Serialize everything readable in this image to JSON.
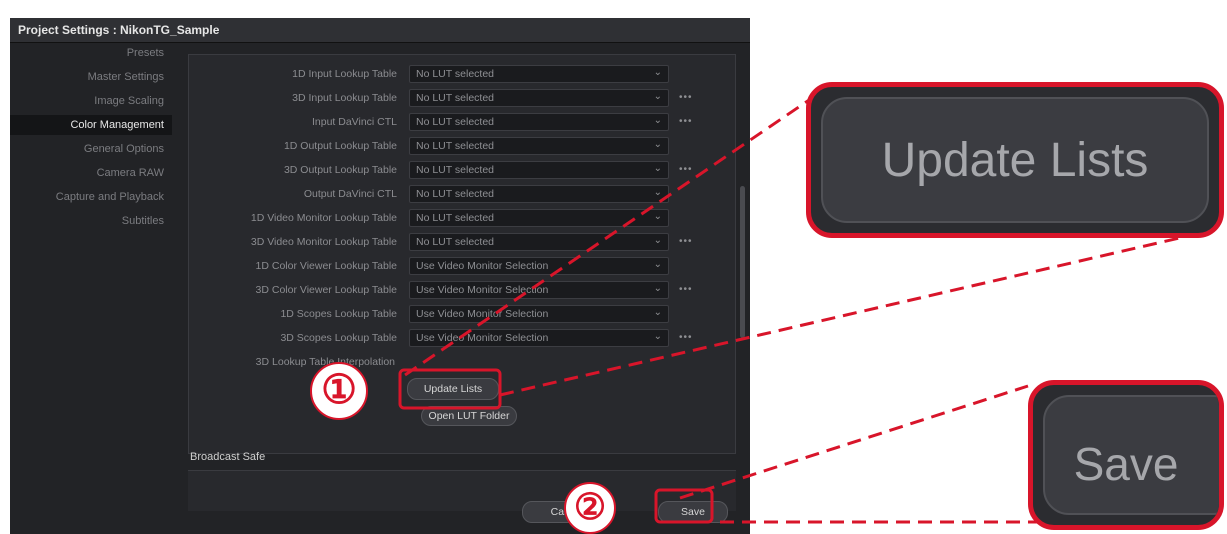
{
  "window": {
    "title": "Project Settings :  NikonTG_Sample"
  },
  "sidebar": {
    "items": [
      {
        "label": "Presets",
        "active": false
      },
      {
        "label": "Master Settings",
        "active": false
      },
      {
        "label": "Image Scaling",
        "active": false
      },
      {
        "label": "Color Management",
        "active": true
      },
      {
        "label": "General Options",
        "active": false
      },
      {
        "label": "Camera RAW",
        "active": false
      },
      {
        "label": "Capture and Playback",
        "active": false
      },
      {
        "label": "Subtitles",
        "active": false
      }
    ]
  },
  "lut_rows": [
    {
      "label": "1D Input Lookup Table",
      "value": "No LUT selected",
      "more": ""
    },
    {
      "label": "3D Input Lookup Table",
      "value": "No LUT selected",
      "more": "•••"
    },
    {
      "label": "Input DaVinci CTL",
      "value": "No LUT selected",
      "more": "•••"
    },
    {
      "label": "1D Output Lookup Table",
      "value": "No LUT selected",
      "more": ""
    },
    {
      "label": "3D Output Lookup Table",
      "value": "No LUT selected",
      "more": "•••"
    },
    {
      "label": "Output DaVinci CTL",
      "value": "No LUT selected",
      "more": ""
    },
    {
      "label": "1D Video Monitor Lookup Table",
      "value": "No LUT selected",
      "more": ""
    },
    {
      "label": "3D Video Monitor Lookup Table",
      "value": "No LUT selected",
      "more": "•••"
    },
    {
      "label": "1D Color Viewer Lookup Table",
      "value": "Use Video Monitor Selection",
      "more": ""
    },
    {
      "label": "3D Color Viewer Lookup Table",
      "value": "Use Video Monitor Selection",
      "more": "•••"
    },
    {
      "label": "1D Scopes Lookup Table",
      "value": "Use Video Monitor Selection",
      "more": ""
    },
    {
      "label": "3D Scopes Lookup Table",
      "value": "Use Video Monitor Selection",
      "more": "•••"
    }
  ],
  "lut_interp_label": "3D Lookup Table Interpolation",
  "buttons": {
    "update_lists": "Update Lists",
    "open_lut_folder": "Open LUT Folder",
    "cancel": "Cancel",
    "save": "Save"
  },
  "broadcast_safe": {
    "title": "Broadcast Safe"
  },
  "callouts": {
    "one": "①",
    "two": "②",
    "zoom_update": "Update Lists",
    "zoom_save": "Save"
  },
  "colors": {
    "accent_red": "#d8152a",
    "panel_bg": "#28292d"
  }
}
